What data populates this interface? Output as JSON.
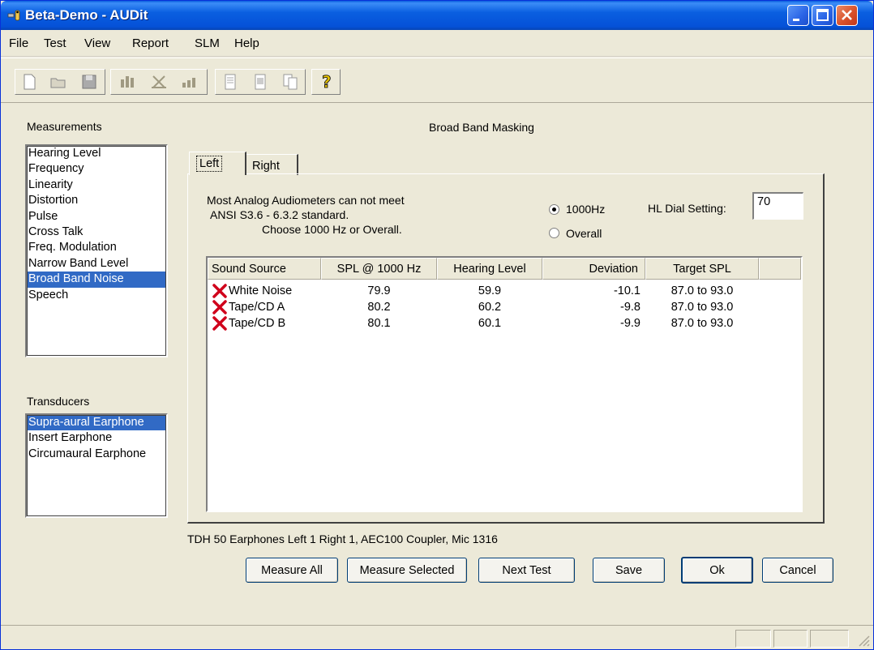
{
  "window": {
    "title": "Beta-Demo - AUDit"
  },
  "menu": [
    "File",
    "Test",
    "View",
    "Report",
    "SLM",
    "Help"
  ],
  "toolbar": {
    "icons": [
      "new-file-icon",
      "open-folder-icon",
      "save-disk-icon",
      "bar-chart-icon",
      "compare-chart-icon",
      "level-chart-icon",
      "report-page-icon",
      "report-list-icon",
      "report-copy-icon",
      "help-question-icon"
    ]
  },
  "measurements": {
    "label": "Measurements",
    "items": [
      "Hearing Level",
      "Frequency",
      "Linearity",
      "Distortion",
      "Pulse",
      "Cross Talk",
      "Freq. Modulation",
      "Narrow Band Level",
      "Broad Band Noise",
      "Speech"
    ],
    "selected": "Broad Band Noise"
  },
  "transducers": {
    "label": "Transducers",
    "items": [
      "Supra-aural Earphone",
      "Insert Earphone",
      "Circumaural Earphone"
    ],
    "selected": "Supra-aural Earphone"
  },
  "panel": {
    "title": "Broad Band Masking",
    "tabs": [
      "Left",
      "Right"
    ],
    "active_tab": "Left",
    "notice_line1": "Most Analog Audiometers can not meet",
    "notice_line2": "ANSI S3.6 - 6.3.2 standard.",
    "notice_line3": "Choose 1000 Hz or Overall.",
    "radio_1000": "1000Hz",
    "radio_overall": "Overall",
    "radio_selected": "1000Hz",
    "hl_dial_label": "HL Dial Setting:",
    "hl_dial_value": "70"
  },
  "table": {
    "headers": [
      "Sound Source",
      "SPL @ 1000 Hz",
      "Hearing Level",
      "Deviation",
      "Target SPL"
    ],
    "rows": [
      {
        "status": "fail",
        "source": "White Noise",
        "spl": "79.9",
        "hl": "59.9",
        "deviation": "-10.1",
        "target": "87.0 to 93.0"
      },
      {
        "status": "fail",
        "source": "Tape/CD A",
        "spl": "80.2",
        "hl": "60.2",
        "deviation": "-9.8",
        "target": "87.0 to 93.0"
      },
      {
        "status": "fail",
        "source": "Tape/CD B",
        "spl": "80.1",
        "hl": "60.1",
        "deviation": "-9.9",
        "target": "87.0 to 93.0"
      }
    ]
  },
  "info_line": "TDH 50 Earphones Left 1 Right 1, AEC100 Coupler, Mic 1316",
  "buttons": {
    "measure_all": "Measure All",
    "measure_selected": "Measure Selected",
    "next_test": "Next Test",
    "save": "Save",
    "ok": "Ok",
    "cancel": "Cancel"
  },
  "colors": {
    "selection": "#316ac5",
    "titlebar": "#0a5fe0",
    "fail_mark": "#d0021b"
  }
}
